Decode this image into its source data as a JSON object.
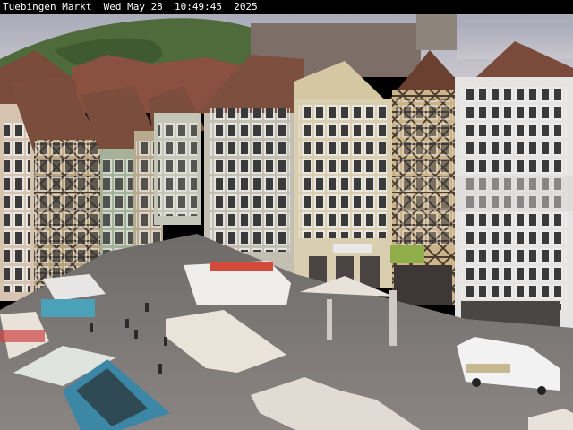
{
  "overlay": {
    "caption": "Tuebingen Markt  Wed May 28  10:49:45  2025"
  },
  "scene": {
    "colors": {
      "sky": "#b7b9c6",
      "hill": "#4f6b3c",
      "roof": "#7a4a3a",
      "plaza": "#7e7a78",
      "awning": "#e9e2db",
      "house_white": "#e6e4e2",
      "house_cream": "#d9cfb0",
      "house_grey": "#b9b8ad",
      "timber": "#5a4a3e"
    }
  }
}
